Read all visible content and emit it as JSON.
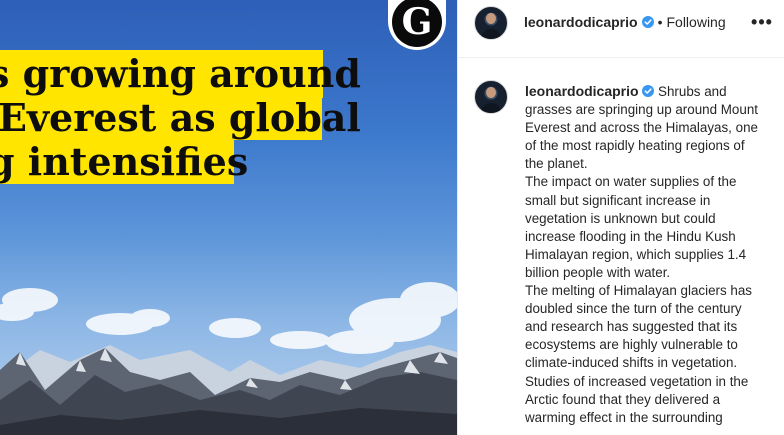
{
  "media": {
    "headline_lines": [
      "s growing around",
      "Everest as global",
      "g intensifies"
    ],
    "publisher_logo_letter": "G",
    "publisher_logo_icon": "guardian-g-icon"
  },
  "header": {
    "username": "leonardodicaprio",
    "separator": "•",
    "follow_status": "Following",
    "more_label": "•••"
  },
  "caption": {
    "username": "leonardodicaprio",
    "paragraphs": [
      "Shrubs and grasses are springing up around Mount Everest and across the Himalayas, one of the most rapidly heating regions of the planet.",
      "The impact on water supplies of the small but significant increase in vegetation is unknown but could increase flooding in the Hindu Kush Himalayan region, which supplies 1.4 billion people with water.",
      "The melting of Himalayan glaciers has doubled since the turn of the century and research has suggested that its ecosystems are highly vulnerable to climate-induced shifts in vegetation.",
      "Studies of increased vegetation in the Arctic found that they delivered a warming effect in the surrounding"
    ]
  },
  "colors": {
    "headline_bg": "#ffe500",
    "verified": "#3897f0",
    "text": "#262626"
  }
}
